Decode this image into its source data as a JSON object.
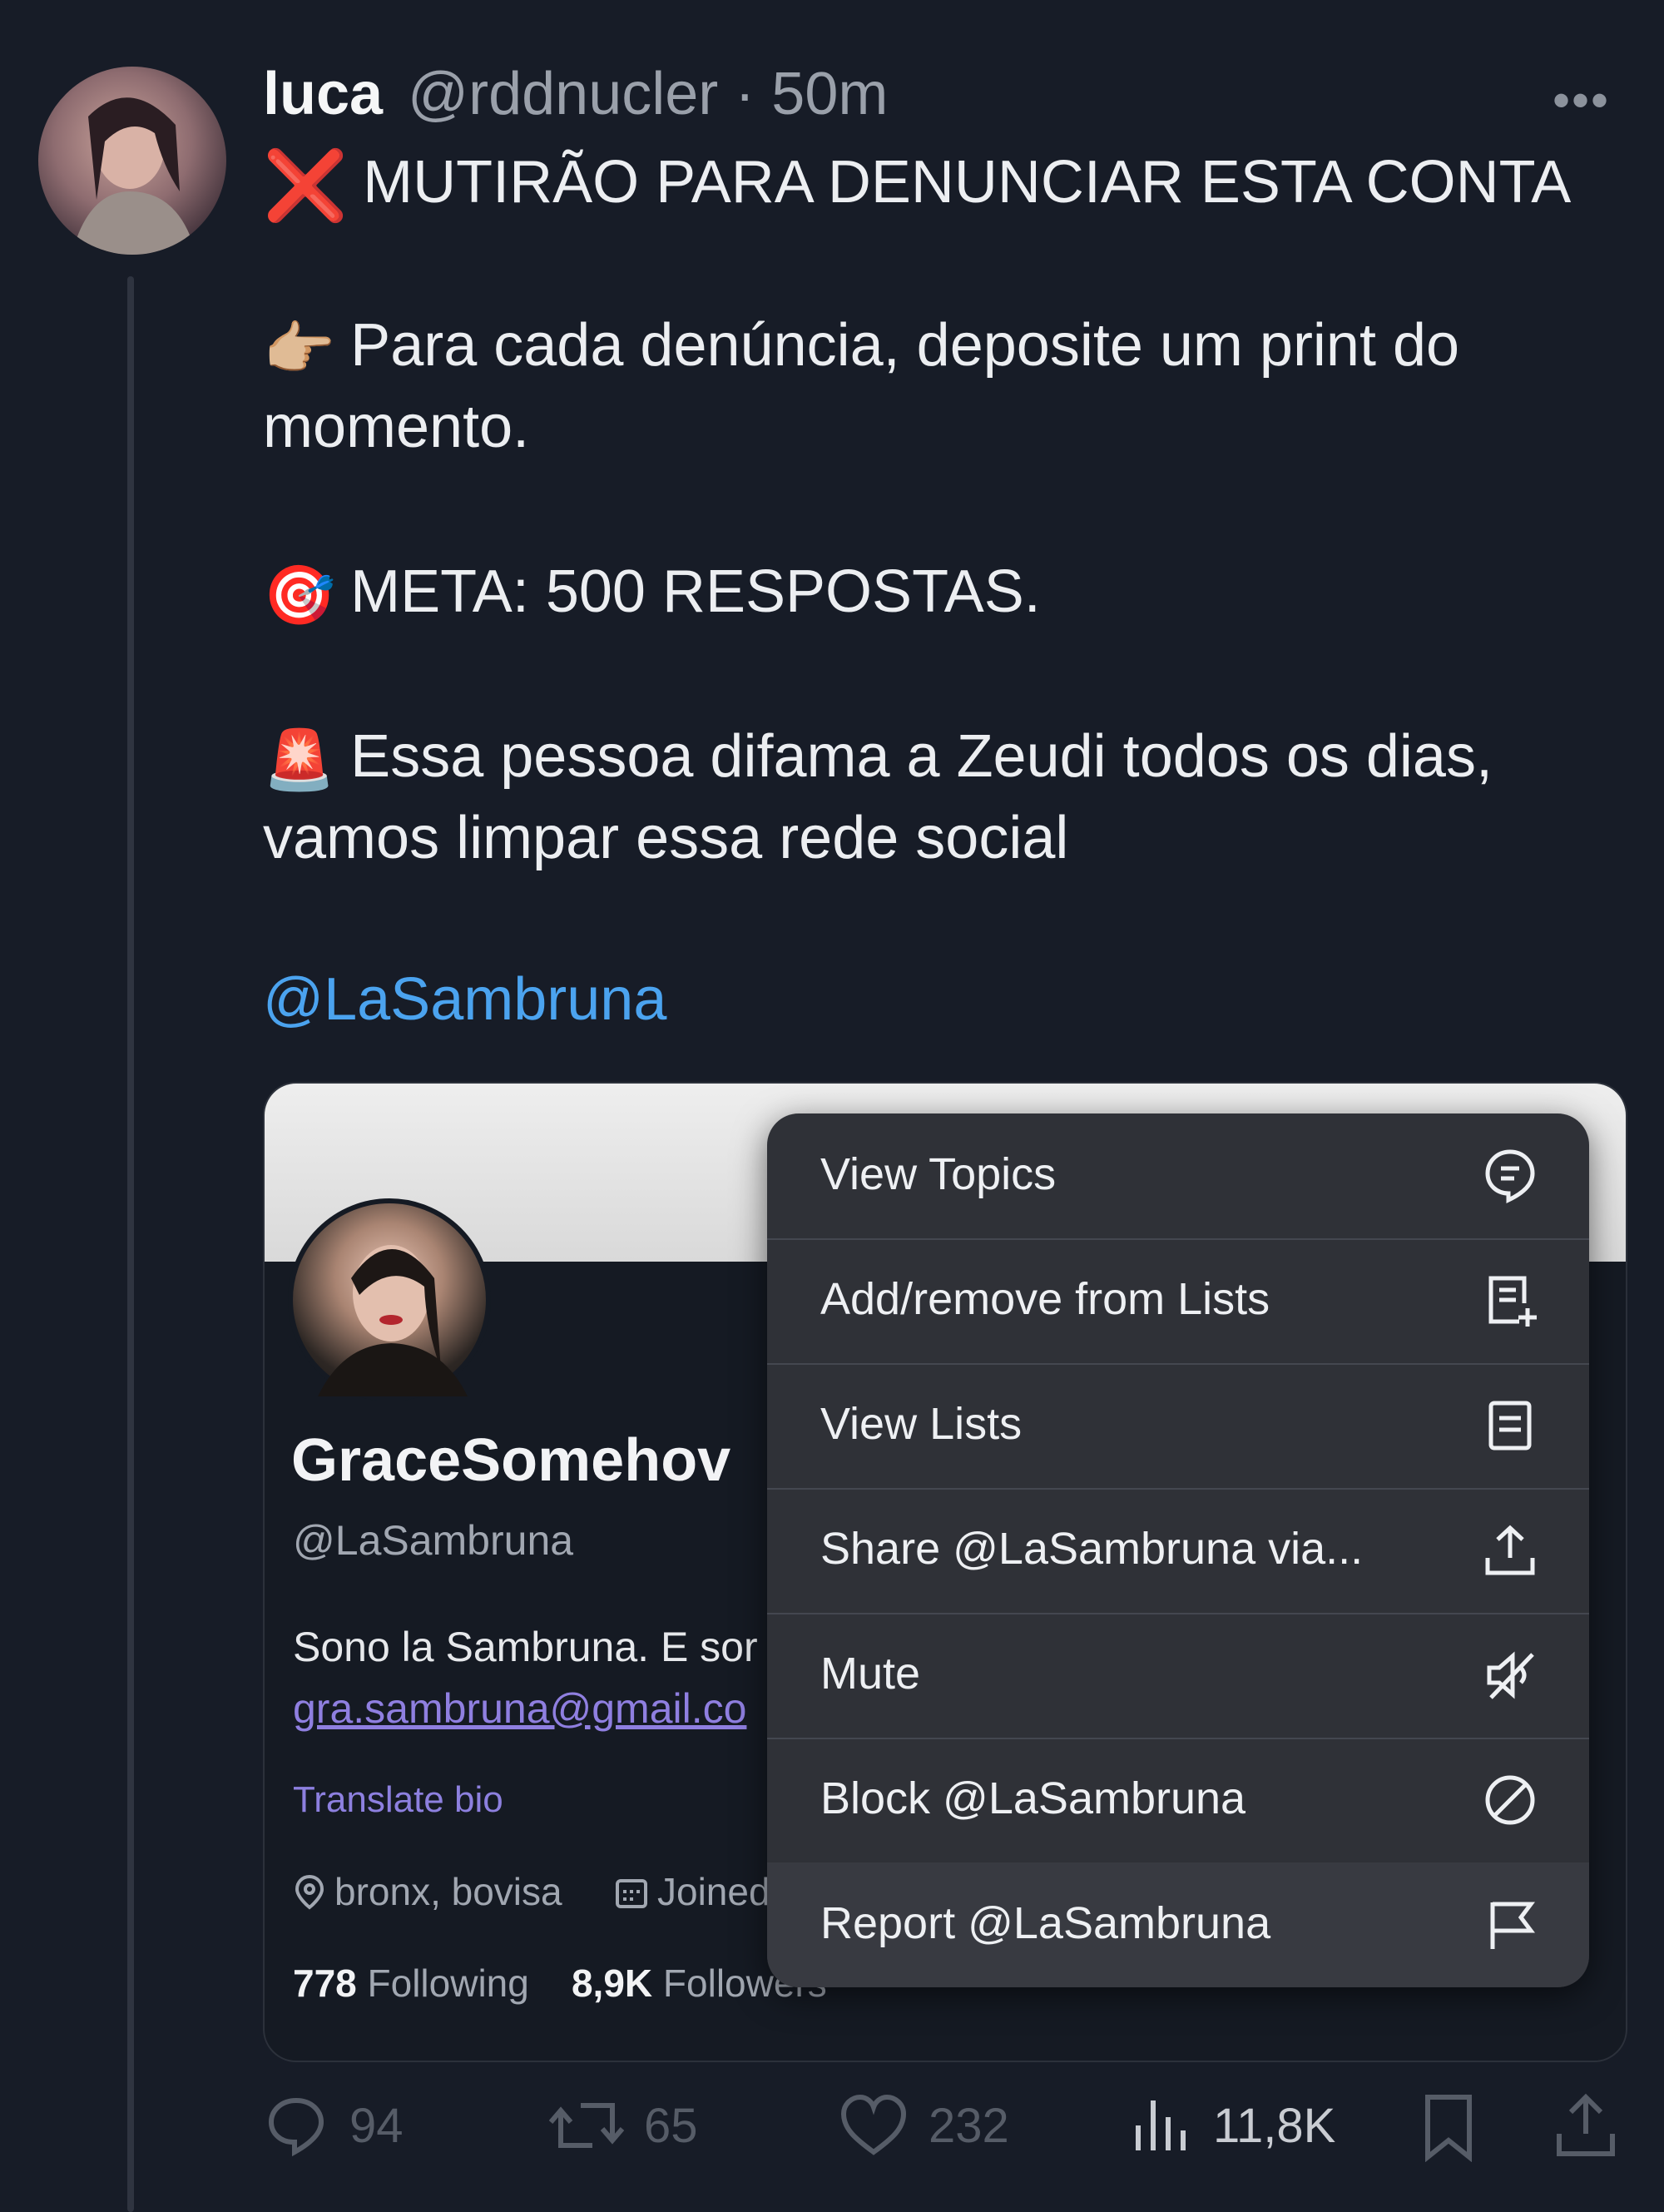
{
  "tweet": {
    "author_name": "luca",
    "author_handle": "@rddnucler",
    "separator": "·",
    "time": "50m",
    "more_glyph": "•••",
    "lines": [
      {
        "emoji": "❌",
        "text": "MUTIRÃO PARA DENUNCIAR ESTA CONTA"
      },
      {
        "emoji": "👉🏼",
        "text": "Para cada denúncia, deposite um print do"
      },
      {
        "emoji": "",
        "text": "momento."
      },
      {
        "emoji": "🎯",
        "text": "META: 500 RESPOSTAS."
      },
      {
        "emoji": "🚨",
        "text": "Essa pessoa difama a Zeudi todos os dias,"
      },
      {
        "emoji": "",
        "text": "vamos limpar essa rede social"
      }
    ],
    "mention": "@LaSambruna"
  },
  "profile_card": {
    "name": "GraceSomehov",
    "handle": "@LaSambruna",
    "bio": "Sono la Sambruna. E sor",
    "email": "gra.sambruna@gmail.co",
    "translate": "Translate bio",
    "location": "bronx, bovisa",
    "joined": "Joined",
    "following_count": "778",
    "following_label": "Following",
    "followers_count": "8,9K",
    "followers_label": "Followers"
  },
  "menu": {
    "items": [
      {
        "label": "View Topics",
        "icon": "topics-icon"
      },
      {
        "label": "Add/remove from Lists",
        "icon": "list-add-icon"
      },
      {
        "label": "View Lists",
        "icon": "list-icon"
      },
      {
        "label": "Share @LaSambruna via...",
        "icon": "share-icon"
      },
      {
        "label": "Mute",
        "icon": "mute-icon"
      },
      {
        "label": "Block @LaSambruna",
        "icon": "block-icon"
      },
      {
        "label": "Report @LaSambruna",
        "icon": "flag-icon"
      }
    ]
  },
  "actions": {
    "replies": "94",
    "retweets": "65",
    "likes": "232",
    "views": "11,8K"
  },
  "colors": {
    "background": "#171c27",
    "link": "#4ba3ef",
    "menu_bg": "#2f3137",
    "muted": "#565c67"
  }
}
